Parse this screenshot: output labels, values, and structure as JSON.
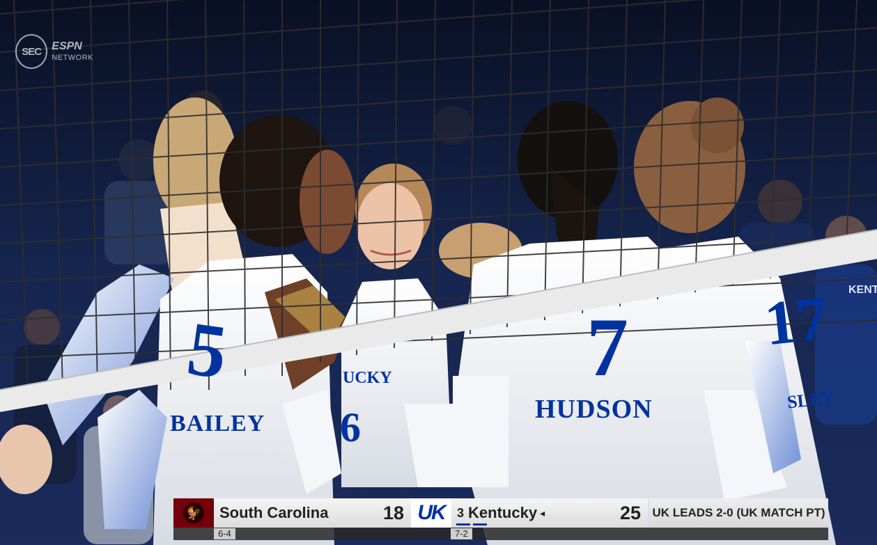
{
  "broadcast": {
    "network_logo_text": "SEC",
    "network_logo_sub1": "ESPN",
    "network_logo_sub2": "NETWORK"
  },
  "players": {
    "jersey_left_number": "5",
    "jersey_left_name": "BAILEY",
    "jersey_center_text": "UCKY",
    "jersey_center_number": "6",
    "jersey_right_number": "7",
    "jersey_right_name": "HUDSON",
    "jersey_far_right_number": "17",
    "jersey_far_right_name": "SLEY",
    "fan_shirt_text": "KENT"
  },
  "scorebug": {
    "team1": {
      "name": "South Carolina",
      "score": "18",
      "record": "6-4",
      "color": "#73000a"
    },
    "team2": {
      "rank": "3",
      "name": "Kentucky",
      "serve_indicator": "◂",
      "score": "25",
      "record": "7-2",
      "color": "#0033a0",
      "logo_text": "UK"
    },
    "status": "UK LEADS 2-0 (UK MATCH PT)"
  },
  "colors": {
    "kentucky_blue": "#0033a0",
    "net_band": "#e8e8e8"
  }
}
